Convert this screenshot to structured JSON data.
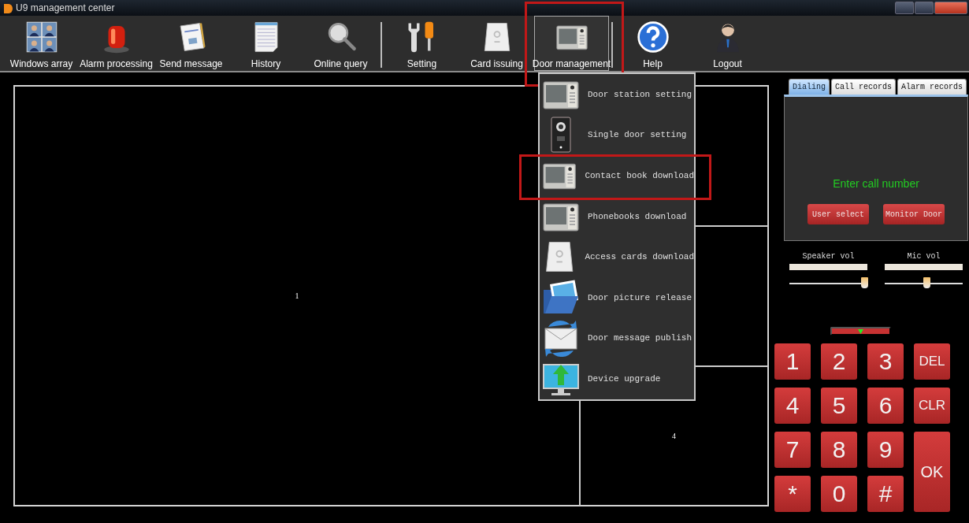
{
  "window": {
    "title": "U9 management center"
  },
  "toolbar": {
    "groups": [
      [
        {
          "label": "Windows array",
          "selected": false,
          "annotated": false
        },
        {
          "label": "Alarm processing",
          "selected": false,
          "annotated": false
        },
        {
          "label": "Send message",
          "selected": false,
          "annotated": false
        },
        {
          "label": "History",
          "selected": false,
          "annotated": false
        },
        {
          "label": "Online query",
          "selected": false,
          "annotated": false
        }
      ],
      [
        {
          "label": "Setting",
          "selected": false,
          "annotated": false
        },
        {
          "label": "Card issuing",
          "selected": false,
          "annotated": false
        },
        {
          "label": "Door management",
          "selected": true,
          "annotated": true
        }
      ],
      [
        {
          "label": "Help",
          "selected": false,
          "annotated": false
        },
        {
          "label": "Logout",
          "selected": false,
          "annotated": false
        }
      ]
    ]
  },
  "dropdown_menu": {
    "items": [
      {
        "label": "Door station setting",
        "annotated": false
      },
      {
        "label": "Single door setting",
        "annotated": false
      },
      {
        "label": "Contact book download",
        "annotated": true
      },
      {
        "label": "Phonebooks download",
        "annotated": false
      },
      {
        "label": "Access cards download",
        "annotated": false
      },
      {
        "label": "Door picture release",
        "annotated": false
      },
      {
        "label": "Door message publish",
        "annotated": false
      },
      {
        "label": "Device upgrade",
        "annotated": false
      }
    ]
  },
  "video_grid": {
    "cells": [
      {
        "label": "1"
      },
      {},
      {},
      {
        "label": "4"
      }
    ]
  },
  "call_panel": {
    "tabs": [
      {
        "label": "Dialing",
        "selected": true
      },
      {
        "label": "Call records",
        "selected": false
      },
      {
        "label": "Alarm records",
        "selected": false
      }
    ],
    "prompt": "Enter call number",
    "buttons": [
      "User select",
      "Monitor Door"
    ]
  },
  "volume": [
    {
      "label": "Speaker vol",
      "level": 0.97
    },
    {
      "label": "Mic vol",
      "level": 0.55
    }
  ],
  "keypad": {
    "keys": [
      {
        "label": "1",
        "kind": "digit"
      },
      {
        "label": "2",
        "kind": "digit"
      },
      {
        "label": "3",
        "kind": "digit"
      },
      {
        "label": "DEL",
        "kind": "function"
      },
      {
        "label": "4",
        "kind": "digit"
      },
      {
        "label": "5",
        "kind": "digit"
      },
      {
        "label": "6",
        "kind": "digit"
      },
      {
        "label": "CLR",
        "kind": "function"
      },
      {
        "label": "7",
        "kind": "digit"
      },
      {
        "label": "8",
        "kind": "digit"
      },
      {
        "label": "9",
        "kind": "digit"
      },
      {
        "label": "OK",
        "kind": "enter"
      },
      {
        "label": "*",
        "kind": "digit"
      },
      {
        "label": "0",
        "kind": "digit"
      },
      {
        "label": "#",
        "kind": "digit"
      }
    ]
  }
}
